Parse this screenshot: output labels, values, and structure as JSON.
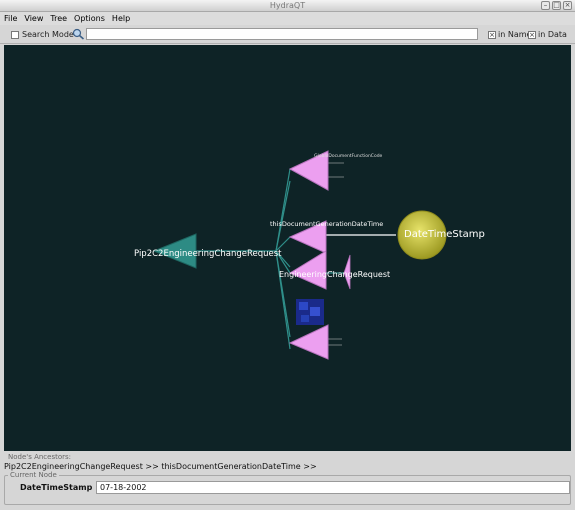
{
  "window": {
    "title": "HydraQT"
  },
  "menu": [
    "File",
    "View",
    "Tree",
    "Options",
    "Help"
  ],
  "toolbar": {
    "search_mode_label": "Search Mode",
    "search_mode_checked": false,
    "search_value": "",
    "in_names_label": "in Names",
    "in_names_checked": true,
    "in_data_label": "in Data",
    "in_data_checked": true
  },
  "graph": {
    "colors": {
      "background": "#0e2326",
      "edge": "#2f8f8a",
      "root": "#2d8b84",
      "child": "#ec9ff0",
      "selected": "#c6c233"
    },
    "root": {
      "label": "Pip2C2EngineeringChangeRequest"
    },
    "children": [
      {
        "label": "GlobalDocumentFunctionCode"
      },
      {
        "label": "thisDocumentGenerationDateTime"
      },
      {
        "label": "EngineeringChangeRequest"
      },
      {
        "label": ""
      },
      {
        "label": ""
      }
    ],
    "selected": {
      "label": "DateTimeStamp"
    }
  },
  "ancestors": {
    "title": "Node's Ancestors:",
    "path": "Pip2C2EngineeringChangeRequest >> thisDocumentGenerationDateTime >>"
  },
  "current_node": {
    "legend": "Current Node",
    "name": "DateTimeStamp",
    "value": "07-18-2002"
  }
}
